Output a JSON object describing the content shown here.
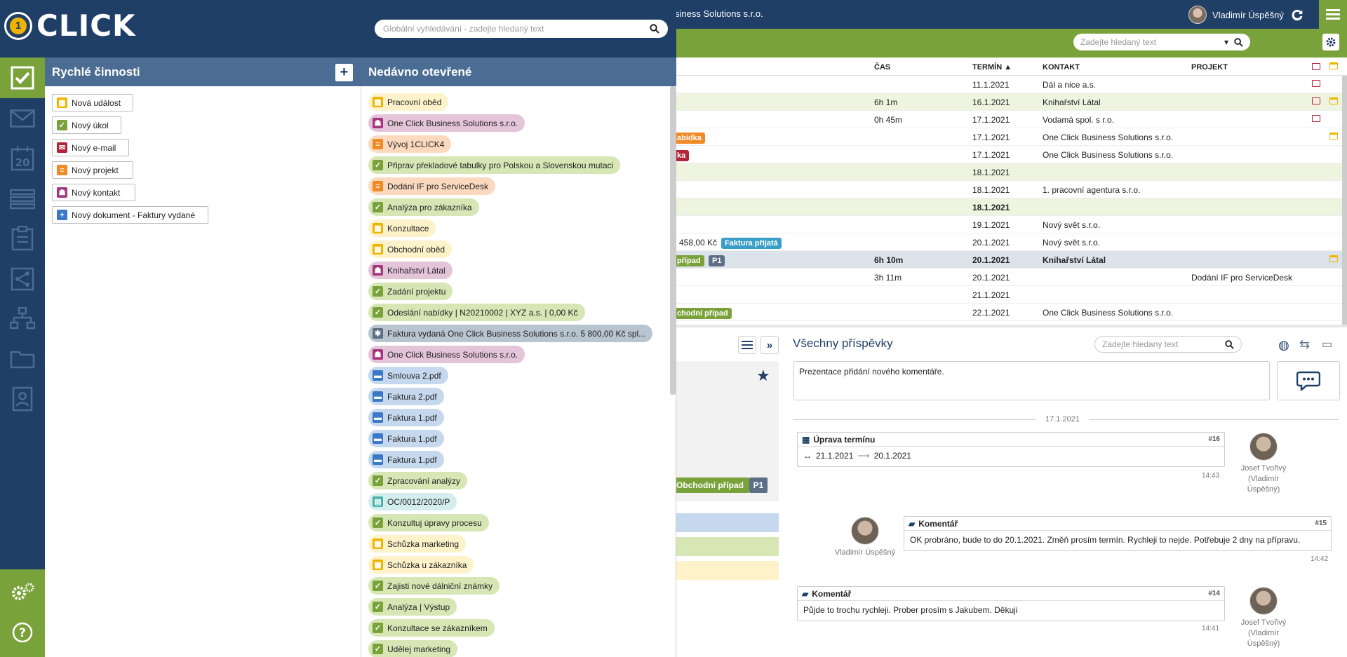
{
  "header": {
    "company": "siness Solutions s.r.o.",
    "user_name": "Vladimír Úspěšný",
    "global_search_placeholder": "Globální vyhledávání - zadejte hledaný text",
    "search_placeholder": "Zadejte hledaný text",
    "logo_digit": "1",
    "logo_text": "CLICK"
  },
  "table": {
    "headers": {
      "time": "ČAS",
      "deadline": "TERMÍN ▲",
      "contact": "KONTAKT",
      "project": "PROJEKT"
    },
    "rows": [
      {
        "time": "",
        "deadline": "11.1.2021",
        "contact": "Dál a nice a.s.",
        "project": "",
        "tag": "",
        "bg": "#fff",
        "bold": false
      },
      {
        "time": "6h 1m",
        "deadline": "16.1.2021",
        "contact": "Knihařství Látal",
        "project": "",
        "tag": "",
        "bg": "#eef4e0",
        "bold": false
      },
      {
        "time": "0h 45m",
        "deadline": "17.1.2021",
        "contact": "Vodamá spol. s r.o.",
        "project": "",
        "tag": "",
        "bg": "#fff",
        "bold": false
      },
      {
        "time": "",
        "deadline": "17.1.2021",
        "contact": "One Click Business Solutions s.r.o.",
        "project": "",
        "tag": "abídka",
        "tagcolor": "#f08a24",
        "bg": "#fff",
        "bold": false
      },
      {
        "time": "",
        "deadline": "17.1.2021",
        "contact": "One Click Business Solutions s.r.o.",
        "project": "",
        "tag": "ka",
        "tagcolor": "#b3243a",
        "bg": "#fff",
        "bold": false
      },
      {
        "time": "",
        "deadline": "18.1.2021",
        "contact": "",
        "project": "",
        "tag": "",
        "bg": "#eef4e0",
        "bold": false
      },
      {
        "time": "",
        "deadline": "18.1.2021",
        "contact": "1. pracovní agentura s.r.o.",
        "project": "",
        "tag": "",
        "bg": "#fff",
        "bold": false
      },
      {
        "time": "",
        "deadline": "18.1.2021",
        "contact": "",
        "project": "",
        "tag": "",
        "bg": "#eef4e0",
        "bold": true
      },
      {
        "time": "",
        "deadline": "19.1.2021",
        "contact": "Nový svět s.r.o.",
        "project": "",
        "tag": "",
        "bg": "#fff",
        "bold": false
      },
      {
        "time": "",
        "deadline": "20.1.2021",
        "contact": "Nový svět s.r.o.",
        "project": "",
        "tag": "Faktura přijatá",
        "tagcolor": "#3a9fc8",
        "amount": "458,00 Kč",
        "bg": "#fff",
        "bold": false
      },
      {
        "time": "6h 10m",
        "deadline": "20.1.2021",
        "contact": "Knihařství Látal",
        "project": "",
        "tag": "případ",
        "tagcolor": "#7aa23a",
        "tag2": "P1",
        "bg": "#dde3ea",
        "bold": true
      },
      {
        "time": "3h 11m",
        "deadline": "20.1.2021",
        "contact": "",
        "project": "Dodání IF pro ServiceDesk",
        "tag": "",
        "bg": "#fff",
        "bold": false
      },
      {
        "time": "",
        "deadline": "21.1.2021",
        "contact": "",
        "project": "",
        "tag": "",
        "bg": "#fff",
        "bold": false
      },
      {
        "time": "",
        "deadline": "22.1.2021",
        "contact": "One Click Business Solutions s.r.o.",
        "project": "",
        "tag": "chodní případ",
        "tagcolor": "#7aa23a",
        "bg": "#fff",
        "bold": false
      }
    ]
  },
  "detail": {
    "badge_case": "Obchodní případ",
    "badge_p": "P1"
  },
  "feed": {
    "title": "Všechny příspěvky",
    "search_placeholder": "Zadejte hledaný text",
    "comment_value": "Prezentace přidání nového komentáře.",
    "date_sep": "17.1.2021",
    "posts": [
      {
        "title": "Úprava termínu",
        "num": "#16",
        "from": "21.1.2021",
        "arrow": "⟶",
        "to": "20.1.2021",
        "time": "14:43",
        "person": "Josef Tvořivý (Vladimír Úspěšný)"
      },
      {
        "title": "Komentář",
        "num": "#15",
        "text": "OK probráno, bude to do 20.1.2021. Změň prosím termín. Rychleji to nejde. Potřebuje 2 dny na přípravu.",
        "time": "14:42",
        "person": "Vladimír Úspěšný"
      },
      {
        "title": "Komentář",
        "num": "#14",
        "text": "Půjde to trochu rychleji. Prober prosím s Jakubem. Děkuji",
        "time": "14:41",
        "person": "Josef Tvořivý (Vladimír Úspěšný)"
      }
    ]
  },
  "quick": {
    "title": "Rychlé činnosti",
    "add_label": "+",
    "actions": [
      {
        "label": "Nová událost",
        "icon": "calendar-icon",
        "color": "#f0b400"
      },
      {
        "label": "Nový úkol",
        "icon": "checkbox-icon",
        "color": "#7aa23a"
      },
      {
        "label": "Nový e-mail",
        "icon": "mail-icon",
        "color": "#b3243a"
      },
      {
        "label": "Nový projekt",
        "icon": "project-icon",
        "color": "#f08a24"
      },
      {
        "label": "Nový kontakt",
        "icon": "contact-icon",
        "color": "#a6367d"
      },
      {
        "label": "Nový dokument - Faktury vydané",
        "icon": "document-icon",
        "color": "#3a78c8"
      }
    ]
  },
  "recent": {
    "title": "Nedávno otevřené",
    "items": [
      {
        "label": "Pracovní oběd",
        "type": "event"
      },
      {
        "label": "One Click Business Solutions s.r.o.",
        "type": "contact"
      },
      {
        "label": "Vývoj 1CLICK4",
        "type": "project"
      },
      {
        "label": "Připrav překladové tabulky pro Polskou a Slovenskou mutaci",
        "type": "task"
      },
      {
        "label": "Dodání IF pro ServiceDesk",
        "type": "project"
      },
      {
        "label": "Analýza pro zákazníka",
        "type": "task"
      },
      {
        "label": "Konzultace",
        "type": "event"
      },
      {
        "label": "Obchodní oběd",
        "type": "event"
      },
      {
        "label": "Knihařství Látal",
        "type": "contact"
      },
      {
        "label": "Zadání projektu",
        "type": "task"
      },
      {
        "label": "Odeslání nabídky | N20210002 | XYZ a.s. | 0,00 Kč",
        "type": "task"
      },
      {
        "label": "Faktura vydaná One Click Business Solutions s.r.o. 5 800,00 Kč spl...",
        "type": "invoice"
      },
      {
        "label": "One Click Business Solutions s.r.o.",
        "type": "contact"
      },
      {
        "label": "Smlouva 2.pdf",
        "type": "file"
      },
      {
        "label": "Faktura 2.pdf",
        "type": "file"
      },
      {
        "label": "Faktura 1.pdf",
        "type": "file"
      },
      {
        "label": "Faktura 1.pdf",
        "type": "file"
      },
      {
        "label": "Faktura 1.pdf",
        "type": "file"
      },
      {
        "label": "Zpracování analýzy",
        "type": "task"
      },
      {
        "label": "OC/0012/2020/P",
        "type": "order"
      },
      {
        "label": "Konzultuj úpravy procesu",
        "type": "task"
      },
      {
        "label": "Schůzka marketing",
        "type": "event"
      },
      {
        "label": "Schůzka u zákazníka",
        "type": "event"
      },
      {
        "label": "Zajisti nové dálniční známky",
        "type": "task"
      },
      {
        "label": "Analýza | Výstup",
        "type": "task"
      },
      {
        "label": "Konzultace se zákazníkem",
        "type": "task"
      },
      {
        "label": "Udělej marketing",
        "type": "task"
      }
    ]
  },
  "types": {
    "event": {
      "bg": "#fdf2c9",
      "ic": "#f0b400",
      "icon": "calendar-icon"
    },
    "contact": {
      "bg": "#e4c4d9",
      "ic": "#a6367d",
      "icon": "contact-icon"
    },
    "project": {
      "bg": "#fbd9bf",
      "ic": "#f08a24",
      "icon": "project-icon"
    },
    "task": {
      "bg": "#d6e6b5",
      "ic": "#7aa23a",
      "icon": "checkbox-icon"
    },
    "invoice": {
      "bg": "#b9c4d1",
      "ic": "#5c6f86",
      "icon": "invoice-icon"
    },
    "file": {
      "bg": "#c5d8ee",
      "ic": "#3a78c8",
      "icon": "folder-icon"
    },
    "order": {
      "bg": "#d4eeed",
      "ic": "#46b0ab",
      "icon": "order-icon"
    }
  }
}
